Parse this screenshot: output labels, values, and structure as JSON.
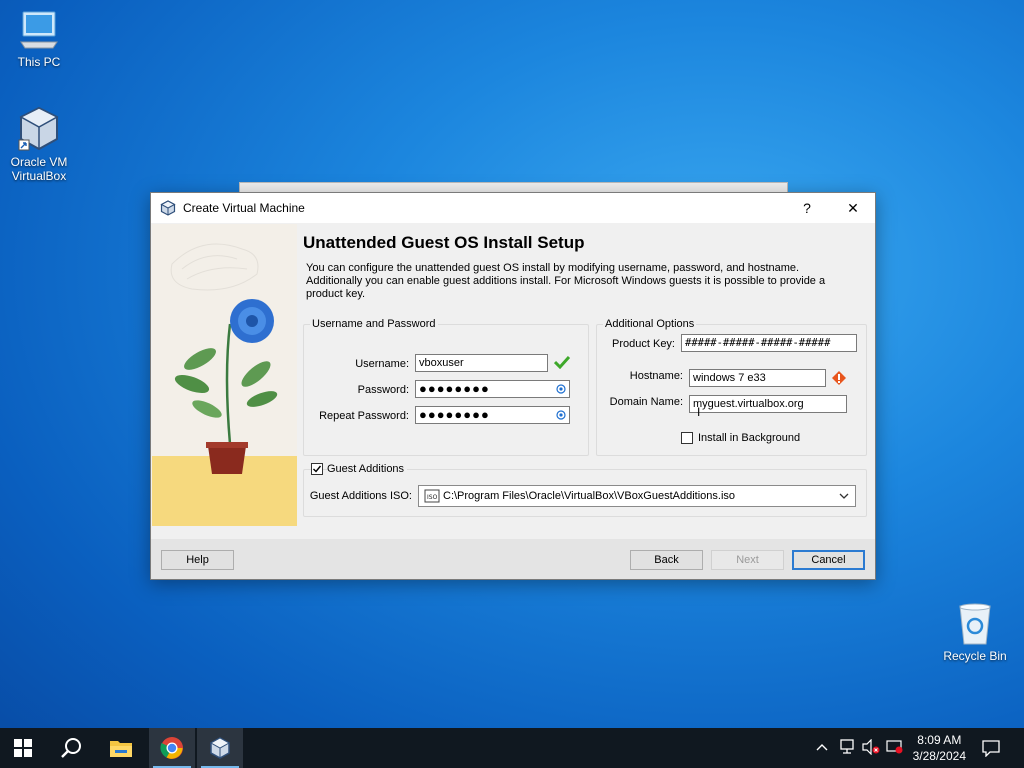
{
  "desktop": {
    "icons": [
      {
        "label": "This PC",
        "icon": "computer-icon"
      },
      {
        "label": "Oracle VM VirtualBox",
        "icon": "virtualbox-icon"
      },
      {
        "label": "Recycle Bin",
        "icon": "recycle-bin-icon"
      }
    ]
  },
  "dialog": {
    "title": "Create Virtual Machine",
    "help_glyph": "?",
    "close_glyph": "✕",
    "heading": "Unattended Guest OS Install Setup",
    "description": "You can configure the unattended guest OS install by modifying username, password, and hostname. Additionally you can enable guest additions install. For Microsoft Windows guests it is possible to provide a product key.",
    "user_group": {
      "title": "Username and Password",
      "username_label": "Username:",
      "username_value": "vboxuser",
      "password_label": "Password:",
      "password_value": "●●●●●●●●",
      "repeat_label": "Repeat Password:",
      "repeat_value": "●●●●●●●●"
    },
    "options_group": {
      "title": "Additional Options",
      "product_key_label": "Product Key:",
      "product_key_value": "#####-#####-#####-#####",
      "hostname_label": "Hostname:",
      "hostname_value": "windows 7 e33",
      "domain_label": "Domain Name:",
      "domain_value": "myguest.virtualbox.org",
      "install_bg_label": "Install in Background",
      "install_bg_checked": false
    },
    "guest_additions": {
      "label": "Guest Additions",
      "checked": true,
      "iso_label": "Guest Additions ISO:",
      "iso_value": "C:\\Program Files\\Oracle\\VirtualBox\\VBoxGuestAdditions.iso"
    },
    "buttons": {
      "help": "Help",
      "back": "Back",
      "next": "Next",
      "cancel": "Cancel"
    }
  },
  "taskbar": {
    "time": "8:09 AM",
    "date": "3/28/2024",
    "apps": [
      "start-icon",
      "search-icon",
      "file-explorer-icon",
      "chrome-icon",
      "virtualbox-icon"
    ]
  },
  "colors": {
    "accent": "#2b7ad1",
    "desktop": "#1c86de",
    "taskbar": "#101820"
  }
}
